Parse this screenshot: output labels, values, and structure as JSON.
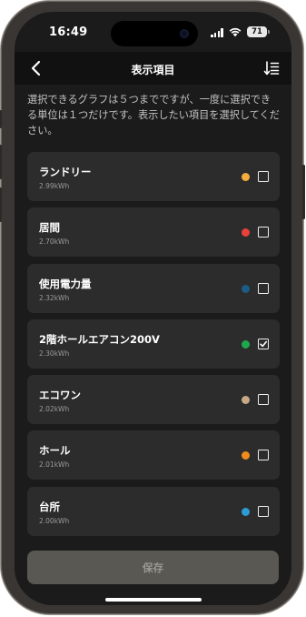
{
  "status_bar": {
    "time": "16:49",
    "battery_level": "71"
  },
  "nav": {
    "title": "表示項目",
    "back_icon": "chevron-left-icon",
    "sort_icon": "sort-icon"
  },
  "description": "選択できるグラフは５つまでですが、一度に選択できる単位は１つだけです。表示したい項目を選択してください。",
  "items": [
    {
      "name": "ランドリー",
      "value": "2.99kWh",
      "color": "#f4ad3d",
      "checked": false
    },
    {
      "name": "居間",
      "value": "2.70kWh",
      "color": "#e9413b",
      "checked": false
    },
    {
      "name": "使用電力量",
      "value": "2.32kWh",
      "color": "#1c5c86",
      "checked": false
    },
    {
      "name": "2階ホールエアコン200V",
      "value": "2.30kWh",
      "color": "#1fa84c",
      "checked": true
    },
    {
      "name": "エコワン",
      "value": "2.02kWh",
      "color": "#c6aa86",
      "checked": false
    },
    {
      "name": "ホール",
      "value": "2.01kWh",
      "color": "#f28b1e",
      "checked": false
    },
    {
      "name": "台所",
      "value": "2.00kWh",
      "color": "#2c9bd6",
      "checked": false
    }
  ],
  "footer": {
    "save_label": "保存"
  }
}
